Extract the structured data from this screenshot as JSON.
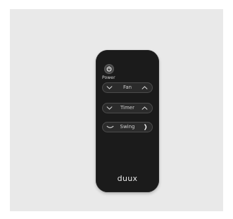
{
  "remote": {
    "power_label": "Power",
    "fan_label": "Fan",
    "timer_label": "Timer",
    "swing_label": "Swing",
    "brand": "duux"
  },
  "icons": {
    "power": "power-icon",
    "down": "chevron-down-icon",
    "up": "chevron-up-icon",
    "swing_left": "swing-left-arc-icon",
    "swing_right": "swing-right-arc-icon"
  },
  "colors": {
    "remote_body": "#1b1b1b",
    "backdrop": "#e9e9e9",
    "text": "#cfcfcf"
  }
}
